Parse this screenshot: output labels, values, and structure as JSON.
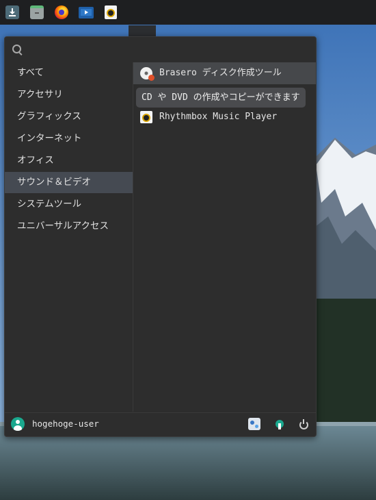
{
  "colors": {
    "panel": "#1e1f21",
    "menu_bg": "#2d2d2d",
    "selected_category": "#454a52",
    "tooltip_bg": "#4a4b4e"
  },
  "panel": {
    "apps_icon": "grid-icon",
    "launchers": [
      "downloads-icon",
      "files-icon",
      "firefox-icon",
      "video-player-icon",
      "rhythmbox-icon"
    ]
  },
  "search": {
    "placeholder": "",
    "value": ""
  },
  "categories": [
    {
      "label": "すべて",
      "selected": false
    },
    {
      "label": "アクセサリ",
      "selected": false
    },
    {
      "label": "グラフィックス",
      "selected": false
    },
    {
      "label": "インターネット",
      "selected": false
    },
    {
      "label": "オフィス",
      "selected": false
    },
    {
      "label": "サウンド＆ビデオ",
      "selected": true
    },
    {
      "label": "システムツール",
      "selected": false
    },
    {
      "label": "ユニバーサルアクセス",
      "selected": false
    }
  ],
  "apps": [
    {
      "label": "Brasero ディスク作成ツール",
      "icon": "brasero-disc-icon",
      "hovered": true
    },
    {
      "label": "",
      "icon": "video-icon",
      "hovered": false
    },
    {
      "label": "Rhythmbox Music Player",
      "icon": "rhythmbox-icon",
      "hovered": false
    }
  ],
  "tooltip": {
    "text": "CD や DVD の作成やコピーができます"
  },
  "footer": {
    "username": "hogehoge-user",
    "actions": [
      "settings-icon",
      "software-icon",
      "power-icon"
    ]
  }
}
